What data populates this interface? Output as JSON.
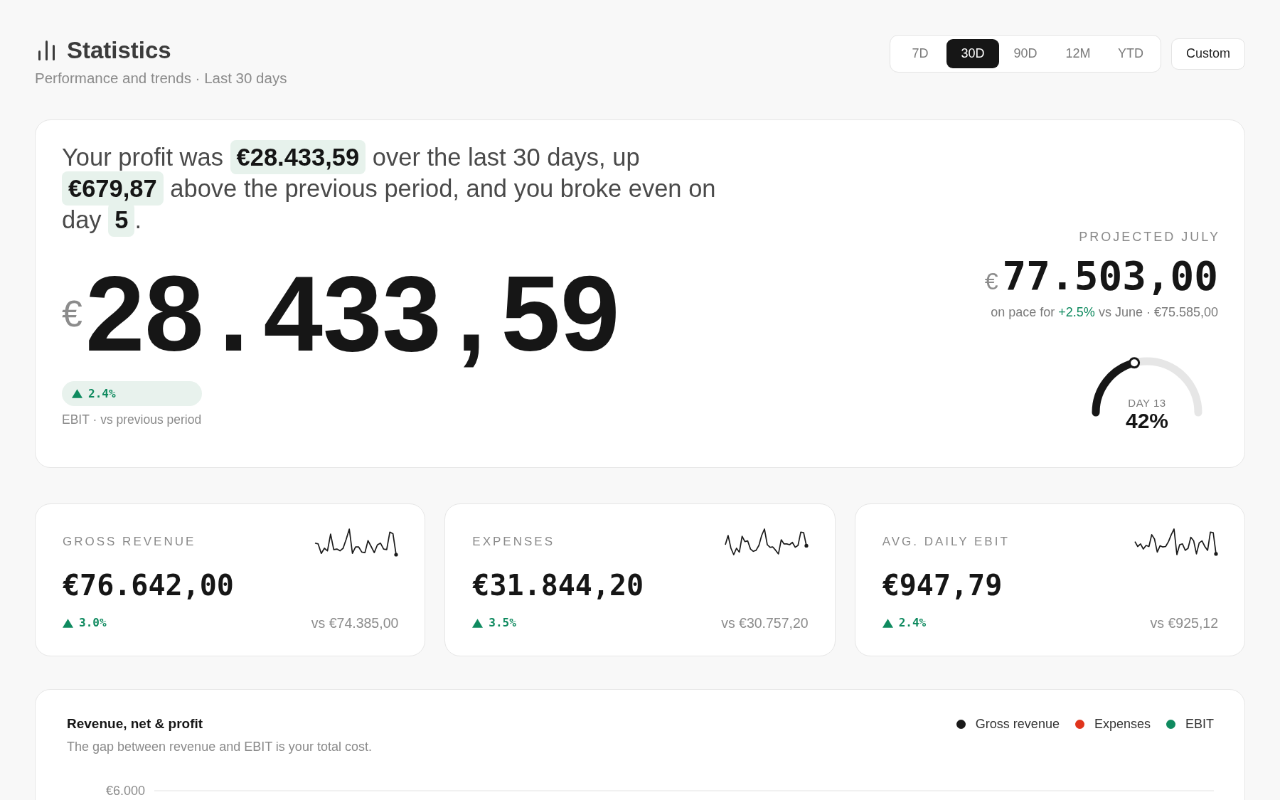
{
  "header": {
    "title": "Statistics",
    "subtitle": "Performance and trends · Last 30 days"
  },
  "periods": [
    {
      "label": "7D",
      "selected": false
    },
    {
      "label": "30D",
      "selected": true
    },
    {
      "label": "90D",
      "selected": false
    },
    {
      "label": "12M",
      "selected": false
    },
    {
      "label": "YTD",
      "selected": false
    }
  ],
  "custom_button": "Custom",
  "summary": {
    "sentence": "Your profit was **€28.433,59** over the last 30 days, up **€679,87** above the previous period, and you broke even on day **5**.",
    "currency": "€",
    "amount": "28.433,59",
    "change": {
      "positive": true,
      "value": "2.4%"
    },
    "caption": "EBIT · vs previous period"
  },
  "projection": {
    "label": "PROJECTED JULY",
    "currency": "€",
    "amount": "77.503,00",
    "note": [
      {
        "text": "on pace for",
        "positive": false
      },
      {
        "text": "+2.5%",
        "positive": true
      },
      {
        "text": "vs June · €75.585,00",
        "positive": false
      }
    ],
    "gauge": {
      "level": 0.42,
      "day": "DAY 13",
      "percent": "42%"
    }
  },
  "metrics": [
    {
      "label": "GROSS REVENUE",
      "value": "€76.642,00",
      "positive": true,
      "change": "3.0%",
      "comparison": "vs €74.385,00"
    },
    {
      "label": "EXPENSES",
      "value": "€31.844,20",
      "positive": true,
      "change": "3.5%",
      "comparison": "vs €30.757,20"
    },
    {
      "label": "AVG. DAILY EBIT",
      "value": "€947,79",
      "positive": true,
      "change": "2.4%",
      "comparison": "vs €925,12"
    }
  ],
  "chart": {
    "title": "Revenue, net & profit",
    "subtitle": "The gap between revenue and EBIT is your total cost.",
    "legend": [
      {
        "label": "Gross revenue",
        "color": "#1a1a1a"
      },
      {
        "label": "Expenses",
        "color": "#e0341c"
      },
      {
        "label": "EBIT",
        "color": "#0f8a5f"
      }
    ],
    "y_axis_labels": [
      "€6.000"
    ]
  }
}
